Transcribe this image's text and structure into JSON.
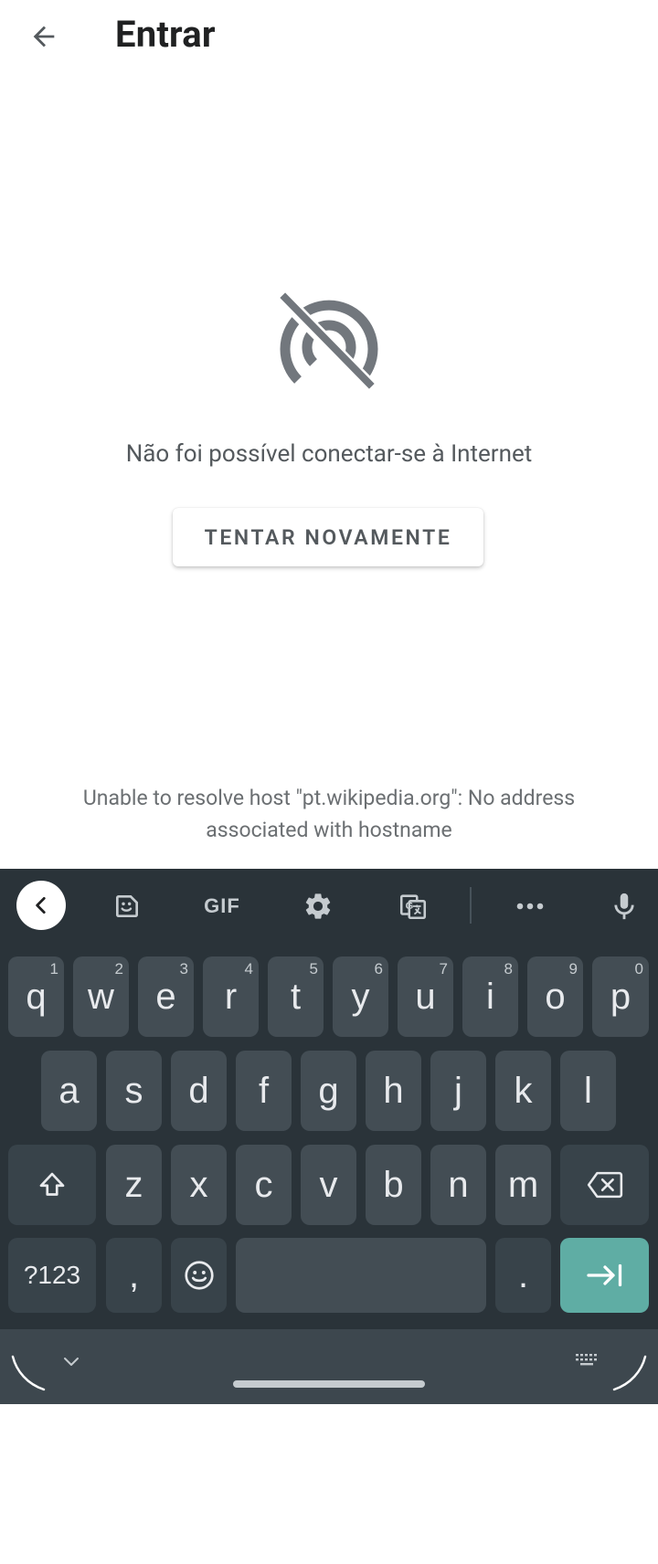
{
  "appbar": {
    "title": "Entrar",
    "back_icon": "arrow-back-icon"
  },
  "error": {
    "icon": "no-connection-icon",
    "message": "Não foi possível conectar-se à Internet",
    "retry_label": "TENTAR NOVAMENTE",
    "detail": "Unable to resolve host \"pt.wikipedia.org\": No address associated with hostname"
  },
  "keyboard": {
    "toolbar": [
      "collapse-icon",
      "sticker-icon",
      "GIF",
      "gear-icon",
      "translate-icon",
      "more-icon",
      "mic-icon"
    ],
    "gif_label": "GIF",
    "row1": [
      {
        "label": "q",
        "hint": "1"
      },
      {
        "label": "w",
        "hint": "2"
      },
      {
        "label": "e",
        "hint": "3"
      },
      {
        "label": "r",
        "hint": "4"
      },
      {
        "label": "t",
        "hint": "5"
      },
      {
        "label": "y",
        "hint": "6"
      },
      {
        "label": "u",
        "hint": "7"
      },
      {
        "label": "i",
        "hint": "8"
      },
      {
        "label": "o",
        "hint": "9"
      },
      {
        "label": "p",
        "hint": "0"
      }
    ],
    "row2": [
      "a",
      "s",
      "d",
      "f",
      "g",
      "h",
      "j",
      "k",
      "l"
    ],
    "row3": [
      "z",
      "x",
      "c",
      "v",
      "b",
      "n",
      "m"
    ],
    "symbols_label": "?123",
    "comma_label": ",",
    "period_label": ".",
    "shift_icon": "shift-icon",
    "backspace_icon": "backspace-icon",
    "emoji_icon": "emoji-icon",
    "enter_icon": "next-field-icon"
  },
  "colors": {
    "keyboard_bg": "#2a3339",
    "key_bg": "#434d54",
    "accent": "#5fada4"
  }
}
